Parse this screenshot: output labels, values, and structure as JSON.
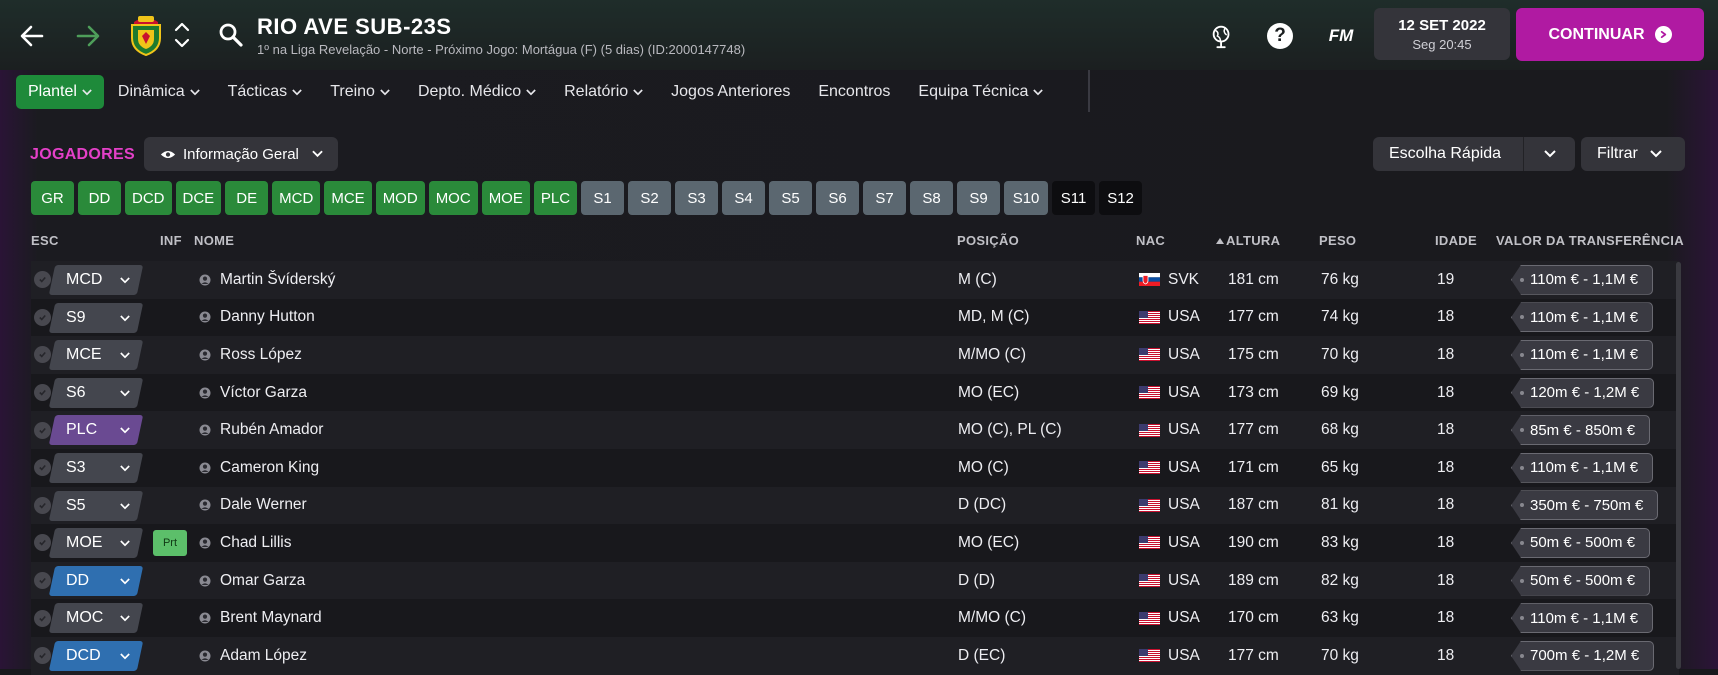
{
  "header": {
    "club_name": "RIO AVE SUB-23S",
    "subtitle": "1º na Liga Revelação - Norte - Próximo Jogo: Mortágua (F) (5 dias) (ID:2000147748)",
    "date": "12 SET 2022",
    "time": "Seg 20:45",
    "fm_label": "FM",
    "help_label": "?",
    "continue_label": "CONTINUAR"
  },
  "menu": [
    {
      "label": "Plantel",
      "chevron": true
    },
    {
      "label": "Dinâmica",
      "chevron": true
    },
    {
      "label": "Tácticas",
      "chevron": true
    },
    {
      "label": "Treino",
      "chevron": true
    },
    {
      "label": "Depto. Médico",
      "chevron": true
    },
    {
      "label": "Relatório",
      "chevron": true
    },
    {
      "label": "Jogos Anteriores",
      "chevron": false
    },
    {
      "label": "Encontros",
      "chevron": false
    },
    {
      "label": "Equipa Técnica",
      "chevron": true
    }
  ],
  "toolbar": {
    "section_title": "JOGADORES",
    "view_label": "Informação Geral",
    "quick_pick_label": "Escolha Rápida",
    "filter_label": "Filtrar"
  },
  "position_filters": [
    {
      "label": "GR",
      "style": "g"
    },
    {
      "label": "DD",
      "style": "g"
    },
    {
      "label": "DCD",
      "style": "g"
    },
    {
      "label": "DCE",
      "style": "g"
    },
    {
      "label": "DE",
      "style": "g"
    },
    {
      "label": "MCD",
      "style": "g"
    },
    {
      "label": "MCE",
      "style": "g"
    },
    {
      "label": "MOD",
      "style": "g"
    },
    {
      "label": "MOC",
      "style": "g"
    },
    {
      "label": "MOE",
      "style": "g"
    },
    {
      "label": "PLC",
      "style": "g"
    },
    {
      "label": "S1",
      "style": "s"
    },
    {
      "label": "S2",
      "style": "s"
    },
    {
      "label": "S3",
      "style": "s"
    },
    {
      "label": "S4",
      "style": "s"
    },
    {
      "label": "S5",
      "style": "s"
    },
    {
      "label": "S6",
      "style": "s"
    },
    {
      "label": "S7",
      "style": "s"
    },
    {
      "label": "S8",
      "style": "s"
    },
    {
      "label": "S9",
      "style": "s"
    },
    {
      "label": "S10",
      "style": "s"
    },
    {
      "label": "S11",
      "style": "k"
    },
    {
      "label": "S12",
      "style": "k"
    }
  ],
  "columns": {
    "esc": "ESC",
    "inf": "INF",
    "name": "NOME",
    "position": "POSIÇÃO",
    "nat": "NAC",
    "height": "ALTURA",
    "weight": "PESO",
    "age": "IDADE",
    "value": "VALOR DA TRANSFERÊNCIA"
  },
  "players": [
    {
      "sel": "MCD",
      "chip": "dark",
      "inf": "",
      "name": "Martin Švíderský",
      "position": "M (C)",
      "flag": "svk",
      "nat": "SVK",
      "height": "181 cm",
      "weight": "76 kg",
      "age": "19",
      "value": "110m € - 1,1M €"
    },
    {
      "sel": "S9",
      "chip": "dark",
      "inf": "",
      "name": "Danny Hutton",
      "position": "MD, M (C)",
      "flag": "usa",
      "nat": "USA",
      "height": "177 cm",
      "weight": "74 kg",
      "age": "18",
      "value": "110m € - 1,1M €"
    },
    {
      "sel": "MCE",
      "chip": "dark",
      "inf": "",
      "name": "Ross López",
      "position": "M/MO (C)",
      "flag": "usa",
      "nat": "USA",
      "height": "175 cm",
      "weight": "70 kg",
      "age": "18",
      "value": "110m € - 1,1M €"
    },
    {
      "sel": "S6",
      "chip": "dark",
      "inf": "",
      "name": "Víctor Garza",
      "position": "MO (EC)",
      "flag": "usa",
      "nat": "USA",
      "height": "173 cm",
      "weight": "69 kg",
      "age": "18",
      "value": "120m € - 1,2M €"
    },
    {
      "sel": "PLC",
      "chip": "purple",
      "inf": "",
      "name": "Rubén Amador",
      "position": "MO (C), PL (C)",
      "flag": "usa",
      "nat": "USA",
      "height": "177 cm",
      "weight": "68 kg",
      "age": "18",
      "value": "85m € - 850m €"
    },
    {
      "sel": "S3",
      "chip": "dark",
      "inf": "",
      "name": "Cameron King",
      "position": "MO (C)",
      "flag": "usa",
      "nat": "USA",
      "height": "171 cm",
      "weight": "65 kg",
      "age": "18",
      "value": "110m € - 1,1M €"
    },
    {
      "sel": "S5",
      "chip": "dark",
      "inf": "",
      "name": "Dale Werner",
      "position": "D (DC)",
      "flag": "usa",
      "nat": "USA",
      "height": "187 cm",
      "weight": "81 kg",
      "age": "18",
      "value": "350m € - 750m €"
    },
    {
      "sel": "MOE",
      "chip": "dark",
      "inf": "Prt",
      "name": "Chad Lillis",
      "position": "MO (EC)",
      "flag": "usa",
      "nat": "USA",
      "height": "190 cm",
      "weight": "83 kg",
      "age": "18",
      "value": "50m € - 500m €"
    },
    {
      "sel": "DD",
      "chip": "blue",
      "inf": "",
      "name": "Omar Garza",
      "position": "D (D)",
      "flag": "usa",
      "nat": "USA",
      "height": "189 cm",
      "weight": "82 kg",
      "age": "18",
      "value": "50m € - 500m €"
    },
    {
      "sel": "MOC",
      "chip": "dark",
      "inf": "",
      "name": "Brent Maynard",
      "position": "M/MO (C)",
      "flag": "usa",
      "nat": "USA",
      "height": "170 cm",
      "weight": "63 kg",
      "age": "18",
      "value": "110m € - 1,1M €"
    },
    {
      "sel": "DCD",
      "chip": "blue",
      "inf": "",
      "name": "Adam López",
      "position": "D (EC)",
      "flag": "usa",
      "nat": "USA",
      "height": "177 cm",
      "weight": "70 kg",
      "age": "18",
      "value": "700m € - 1,2M €"
    }
  ],
  "colors": {
    "accent_magenta": "#b01aa2",
    "menu_active_green": "#1e8a3a",
    "section_title_pink": "#e440c8",
    "filter_green": "#2a8a3a",
    "filter_slate": "#5b6770"
  },
  "icons": {
    "back": "arrow-left-icon",
    "forward": "arrow-right-icon",
    "crest": "club-crest-icon",
    "search": "search-icon",
    "globe": "globe-pin-icon",
    "help": "help-icon",
    "continue": "arrow-circle-icon",
    "eye": "eye-icon",
    "chevron": "chevron-down-icon",
    "sort": "sort-ascending-icon",
    "person": "person-icon",
    "check": "check-icon"
  }
}
